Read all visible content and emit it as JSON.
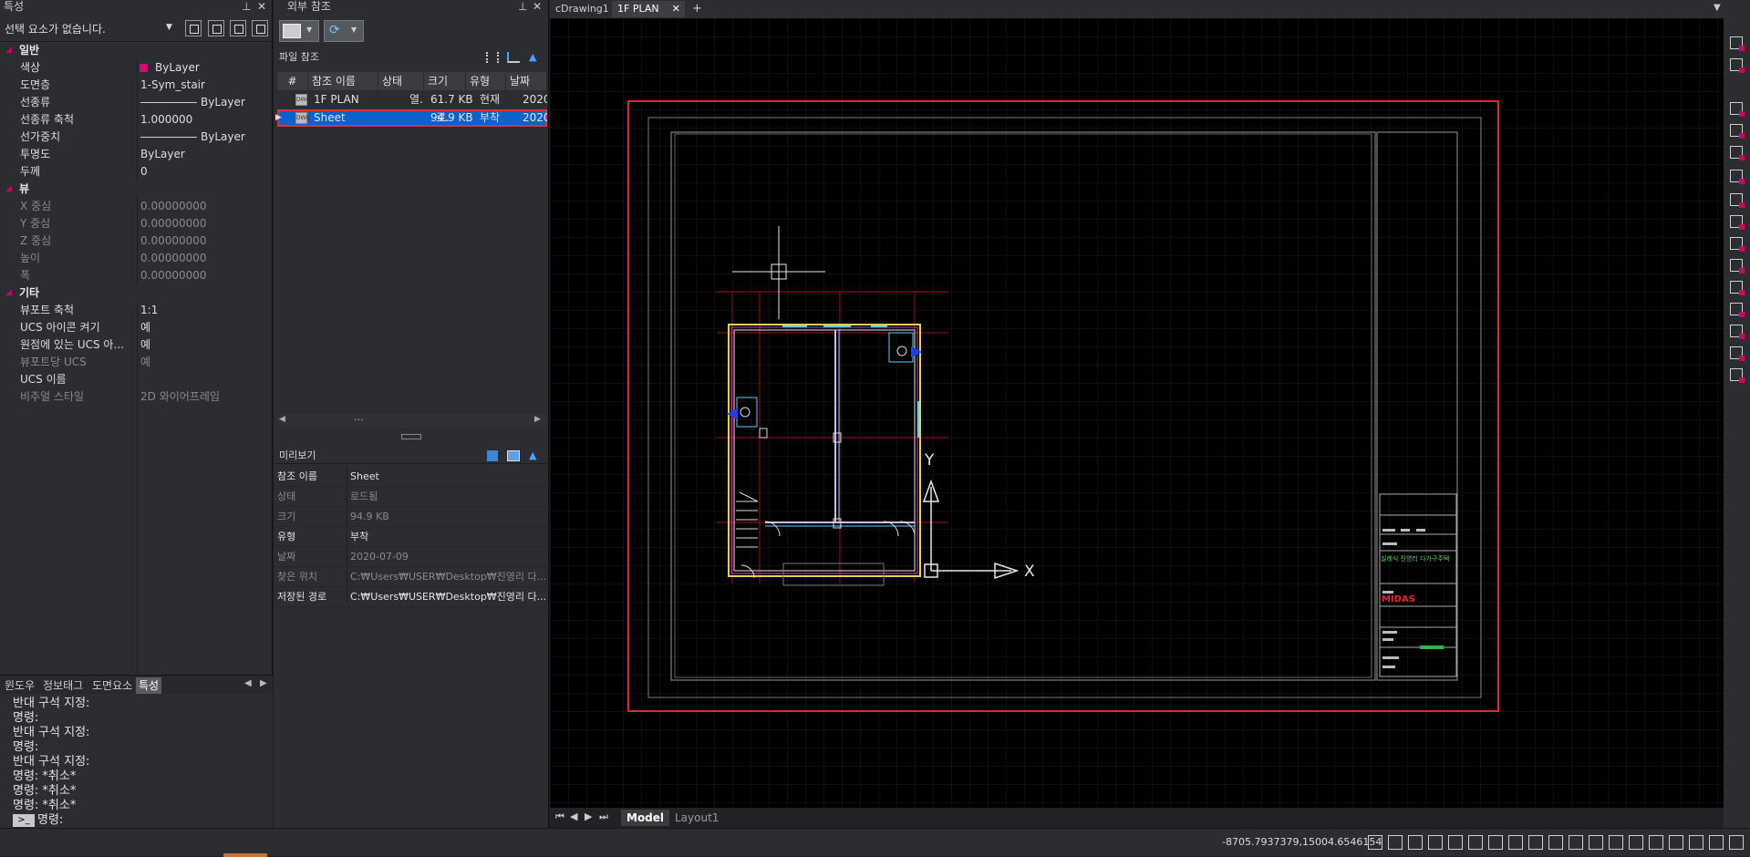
{
  "properties": {
    "title": "특성",
    "selection": "선택 요소가 없습니다.",
    "categories": [
      {
        "name": "일반",
        "rows": [
          {
            "k": "색상",
            "v": "ByLayer",
            "swatch": "#e0007a"
          },
          {
            "k": "도면층",
            "v": "1-Sym_stair"
          },
          {
            "k": "선종류",
            "v": "ByLayer",
            "line": true
          },
          {
            "k": "선종류 축척",
            "v": "1.000000"
          },
          {
            "k": "선가중치",
            "v": "ByLayer",
            "line": true
          },
          {
            "k": "투명도",
            "v": "ByLayer"
          },
          {
            "k": "두께",
            "v": "0"
          }
        ]
      },
      {
        "name": "뷰",
        "rows": [
          {
            "k": "X 중심",
            "v": "0.00000000",
            "dim": true
          },
          {
            "k": "Y 중심",
            "v": "0.00000000",
            "dim": true
          },
          {
            "k": "Z 중심",
            "v": "0.00000000",
            "dim": true
          },
          {
            "k": "높이",
            "v": "0.00000000",
            "dim": true
          },
          {
            "k": "폭",
            "v": "0.00000000",
            "dim": true
          }
        ]
      },
      {
        "name": "기타",
        "rows": [
          {
            "k": "뷰포트 축척",
            "v": "1:1"
          },
          {
            "k": "UCS 아이콘 켜기",
            "v": "예"
          },
          {
            "k": "원점에 있는 UCS 아...",
            "v": "예"
          },
          {
            "k": "뷰포트당 UCS",
            "v": "예",
            "dim": true
          },
          {
            "k": "UCS 이름",
            "v": ""
          },
          {
            "k": "비주얼 스타일",
            "v": "2D 와이어프레임",
            "dim": true
          }
        ]
      }
    ],
    "tabs": [
      "윈도우",
      "정보태그",
      "도면요소",
      "특성"
    ],
    "active_tab": "특성"
  },
  "command_history": [
    "반대 구석 지정:",
    "명령:",
    "반대 구석 지정:",
    "명령:",
    "반대 구석 지정:",
    "명령: *취소*",
    "명령: *취소*",
    "명령: *취소*"
  ],
  "command_prompt": "명령:",
  "xref": {
    "title": "외부 참조",
    "file_refs_label": "파일 참조",
    "columns": [
      "#",
      "참조 이름",
      "상태",
      "크기",
      "유형",
      "날짜"
    ],
    "rows": [
      {
        "name": "1F PLAN",
        "status": "열...",
        "size": "61.7 KB",
        "type": "현재",
        "date": "2020-"
      },
      {
        "name": "Sheet",
        "status": "로...",
        "size": "94.9 KB",
        "type": "부착",
        "date": "2020-"
      }
    ],
    "scroll_dots": "...",
    "preview_label": "미리보기",
    "details": [
      {
        "k": "참조 이름",
        "v": "Sheet"
      },
      {
        "k": "상태",
        "v": "로드됨",
        "dim": true
      },
      {
        "k": "크기",
        "v": "94.9 KB",
        "dim": true
      },
      {
        "k": "유형",
        "v": "부착"
      },
      {
        "k": "날짜",
        "v": "2020-07-09",
        "dim": true
      },
      {
        "k": "찾은 위치",
        "v": "C:₩Users₩USER₩Desktop₩진영리 다...",
        "dim": true
      },
      {
        "k": "저장된 경로",
        "v": "C:₩Users₩USER₩Desktop₩진영리 다..."
      }
    ]
  },
  "drawing_tabs": [
    "cDrawing1",
    "1F PLAN"
  ],
  "active_drawing_tab": "1F PLAN",
  "add_tab": "+",
  "layout_tabs": [
    "Model",
    "Layout1"
  ],
  "ucs_labels": {
    "x": "X",
    "y": "Y"
  },
  "title_block_text": "실례식 진영리 다가구주택",
  "title_block_logo": "MIDAS",
  "coordinates": "-8705.7937379,15004.6546154",
  "colors": {
    "border": "#e8242e",
    "accent": "#d0006a",
    "selection": "#0a64c8"
  }
}
